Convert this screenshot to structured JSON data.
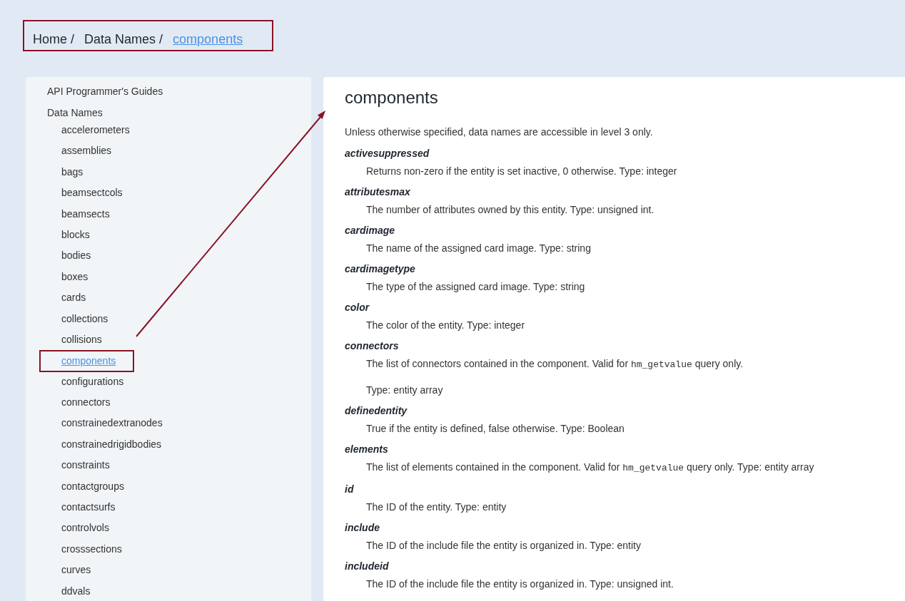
{
  "breadcrumb": {
    "highlighted": true,
    "items": [
      {
        "label": "Home",
        "separator": "/",
        "current": false
      },
      {
        "label": "Data Names",
        "separator": "/",
        "current": false
      },
      {
        "label": "components",
        "current": true
      }
    ]
  },
  "sidebar": {
    "items": [
      {
        "label": "API Programmer's Guides",
        "selected": false,
        "highlighted": false
      },
      {
        "label": "Data Names",
        "selected": false,
        "highlighted": false,
        "children": [
          {
            "label": "accelerometers",
            "selected": false,
            "highlighted": false
          },
          {
            "label": "assemblies",
            "selected": false,
            "highlighted": false
          },
          {
            "label": "bags",
            "selected": false,
            "highlighted": false
          },
          {
            "label": "beamsectcols",
            "selected": false,
            "highlighted": false
          },
          {
            "label": "beamsects",
            "selected": false,
            "highlighted": false
          },
          {
            "label": "blocks",
            "selected": false,
            "highlighted": false
          },
          {
            "label": "bodies",
            "selected": false,
            "highlighted": false
          },
          {
            "label": "boxes",
            "selected": false,
            "highlighted": false
          },
          {
            "label": "cards",
            "selected": false,
            "highlighted": false
          },
          {
            "label": "collections",
            "selected": false,
            "highlighted": false
          },
          {
            "label": "collisions",
            "selected": false,
            "highlighted": false
          },
          {
            "label": "components",
            "selected": true,
            "highlighted": true
          },
          {
            "label": "configurations",
            "selected": false,
            "highlighted": false
          },
          {
            "label": "connectors",
            "selected": false,
            "highlighted": false
          },
          {
            "label": "constrainedextranodes",
            "selected": false,
            "highlighted": false
          },
          {
            "label": "constrainedrigidbodies",
            "selected": false,
            "highlighted": false
          },
          {
            "label": "constraints",
            "selected": false,
            "highlighted": false
          },
          {
            "label": "contactgroups",
            "selected": false,
            "highlighted": false
          },
          {
            "label": "contactsurfs",
            "selected": false,
            "highlighted": false
          },
          {
            "label": "controlvols",
            "selected": false,
            "highlighted": false
          },
          {
            "label": "crosssections",
            "selected": false,
            "highlighted": false
          },
          {
            "label": "curves",
            "selected": false,
            "highlighted": false
          },
          {
            "label": "ddvals",
            "selected": false,
            "highlighted": false
          }
        ]
      }
    ]
  },
  "content": {
    "title": "components",
    "intro": "Unless otherwise specified, data names are accessible in level 3 only.",
    "entries": [
      {
        "term": "activesuppressed",
        "paragraphs": [
          [
            {
              "kind": "text",
              "text": "Returns non-zero if the entity is set inactive, 0 otherwise. Type: integer"
            }
          ]
        ]
      },
      {
        "term": "attributesmax",
        "paragraphs": [
          [
            {
              "kind": "text",
              "text": "The number of attributes owned by this entity. Type: unsigned int."
            }
          ]
        ]
      },
      {
        "term": "cardimage",
        "paragraphs": [
          [
            {
              "kind": "text",
              "text": "The name of the assigned card image. Type: string"
            }
          ]
        ]
      },
      {
        "term": "cardimagetype",
        "paragraphs": [
          [
            {
              "kind": "text",
              "text": "The type of the assigned card image. Type: string"
            }
          ]
        ]
      },
      {
        "term": "color",
        "paragraphs": [
          [
            {
              "kind": "text",
              "text": "The color of the entity. Type: integer"
            }
          ]
        ]
      },
      {
        "term": "connectors",
        "paragraphs": [
          [
            {
              "kind": "text",
              "text": "The list of connectors contained in the component. Valid for "
            },
            {
              "kind": "code",
              "text": "hm_getvalue"
            },
            {
              "kind": "text",
              "text": " query only."
            }
          ],
          [
            {
              "kind": "text",
              "text": "Type: entity array"
            }
          ]
        ]
      },
      {
        "term": "definedentity",
        "paragraphs": [
          [
            {
              "kind": "text",
              "text": "True if the entity is defined, false otherwise. Type: Boolean"
            }
          ]
        ]
      },
      {
        "term": "elements",
        "paragraphs": [
          [
            {
              "kind": "text",
              "text": "The list of elements contained in the component. Valid for "
            },
            {
              "kind": "code",
              "text": "hm_getvalue"
            },
            {
              "kind": "text",
              "text": " query only. Type: entity array"
            }
          ]
        ]
      },
      {
        "term": "id",
        "paragraphs": [
          [
            {
              "kind": "text",
              "text": "The ID of the entity. Type: entity"
            }
          ]
        ]
      },
      {
        "term": "include",
        "paragraphs": [
          [
            {
              "kind": "text",
              "text": "The ID of the include file the entity is organized in. Type: entity"
            }
          ]
        ]
      },
      {
        "term": "includeid",
        "paragraphs": [
          [
            {
              "kind": "text",
              "text": "The ID of the include file the entity is organized in. Type: unsigned int."
            }
          ]
        ]
      }
    ]
  },
  "annotation_arrow": true
}
